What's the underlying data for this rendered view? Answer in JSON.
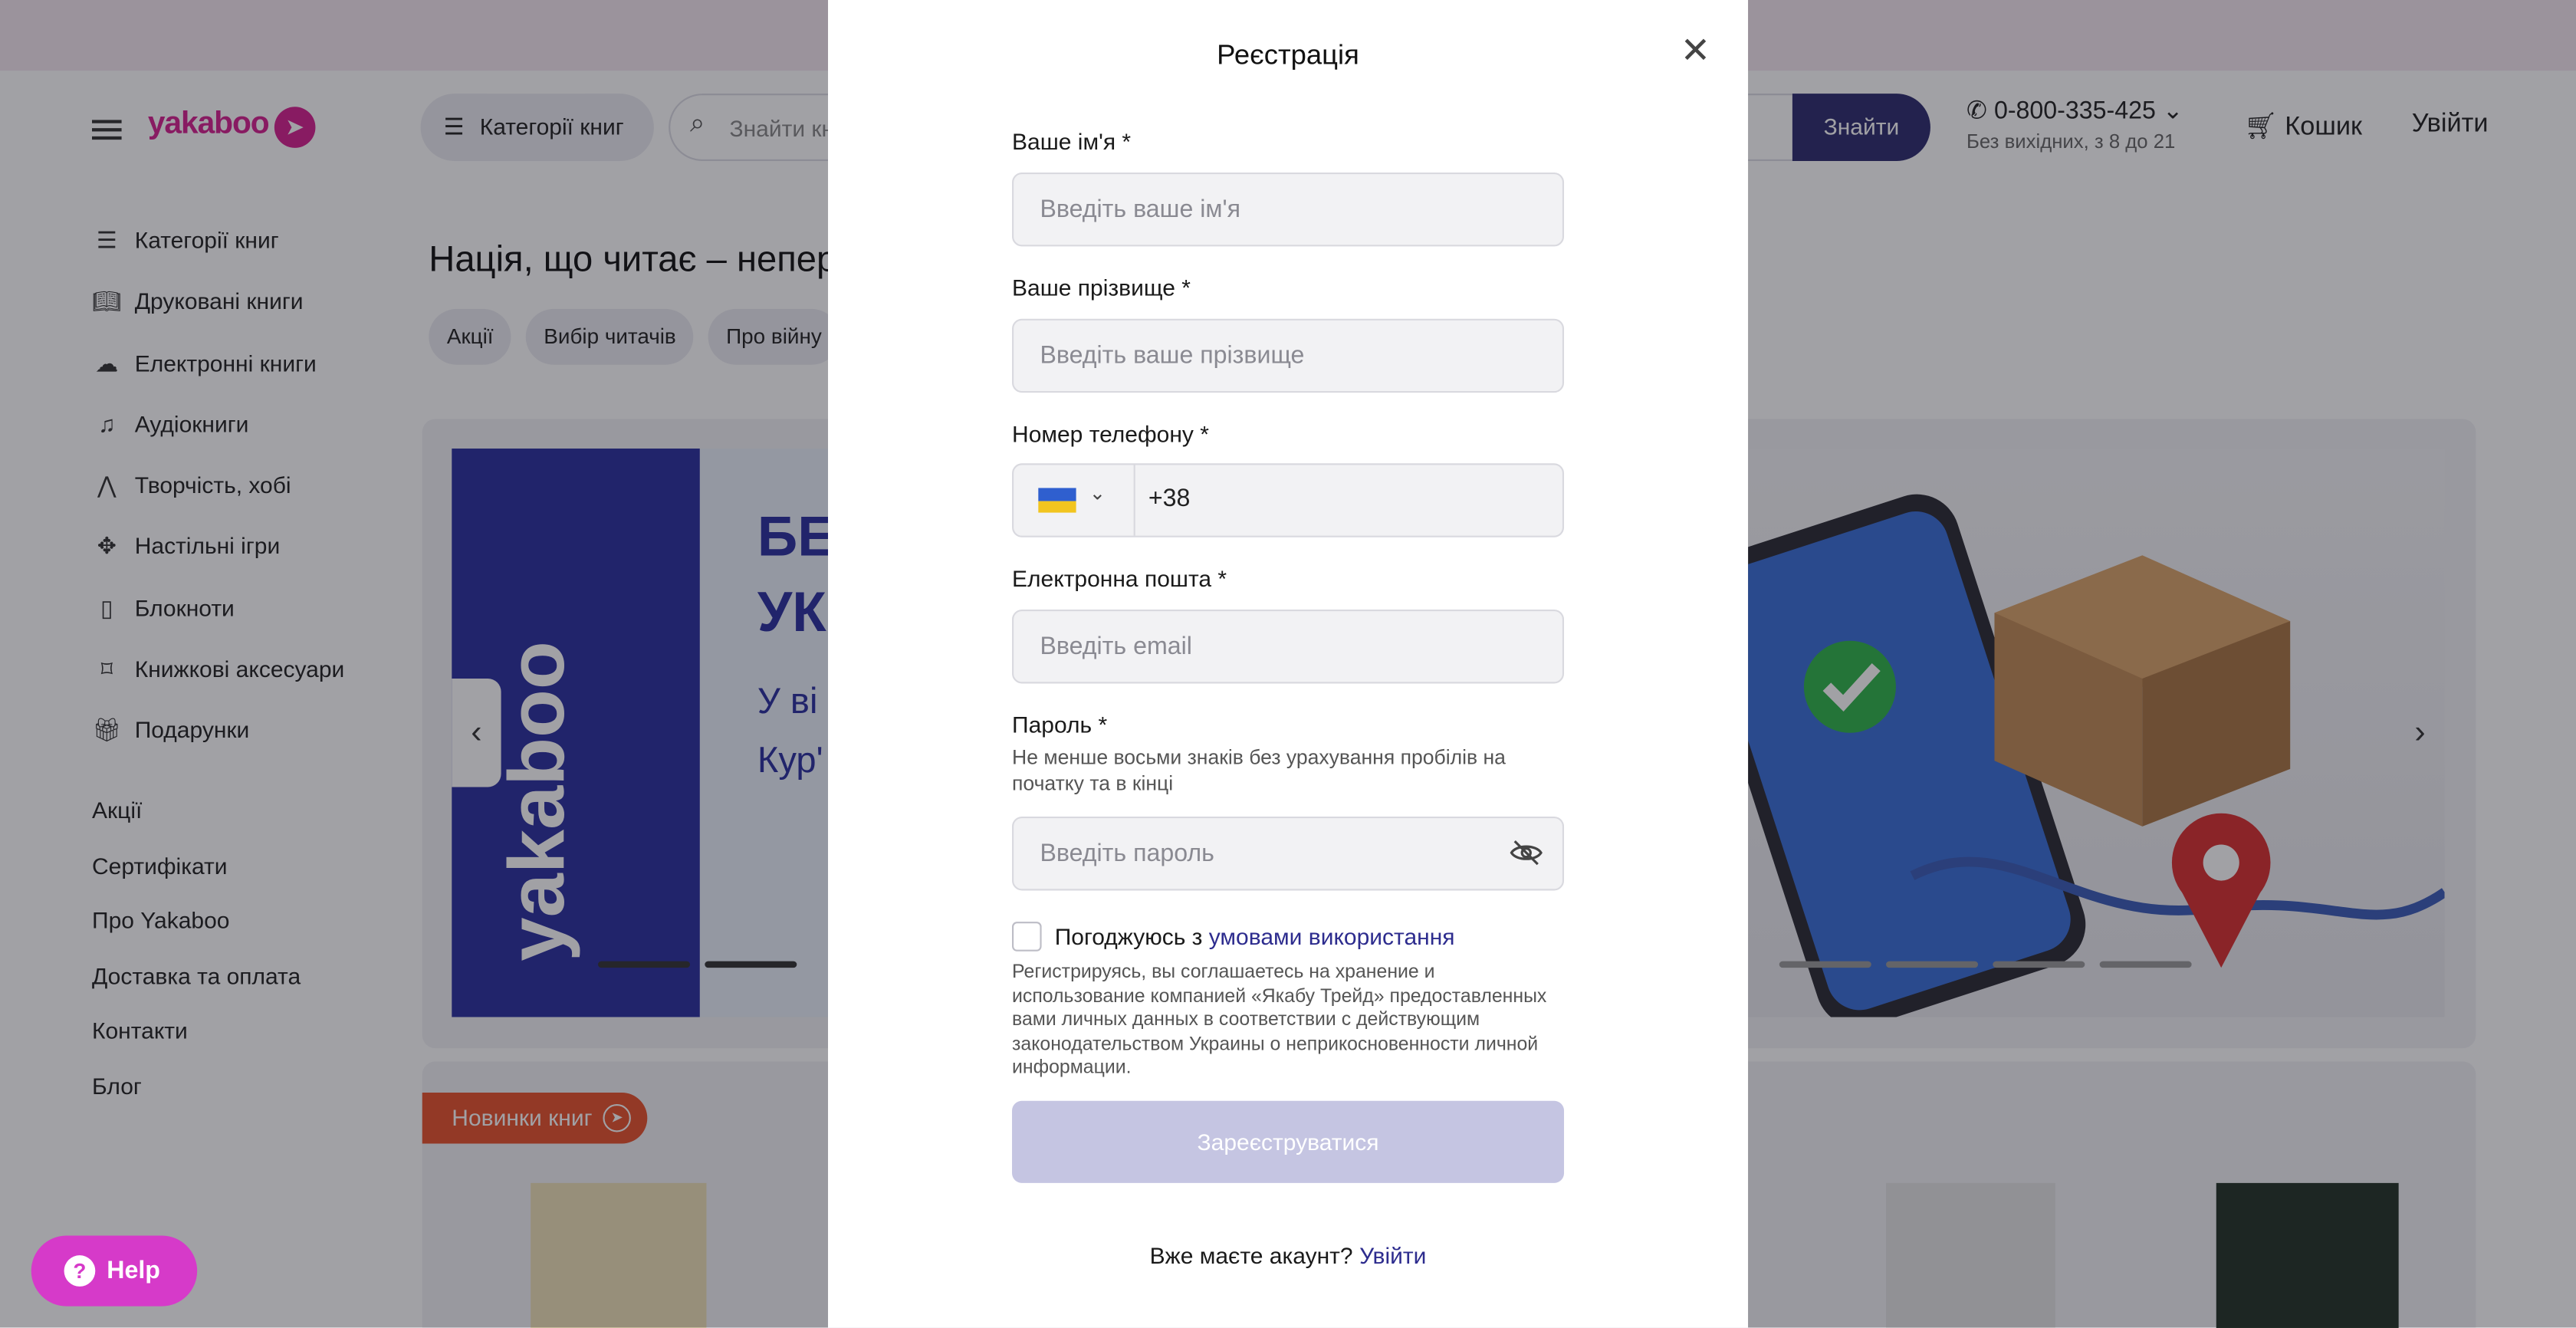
{
  "header": {
    "logo": "yakaboo",
    "categories_btn": "Категорії книг",
    "search_placeholder": "Знайти книгу, автора, серію",
    "search_btn": "Знайти",
    "phone": "0-800-335-425",
    "phone_hours": "Без вихідних, з 8 до 21",
    "cart": "Кошик",
    "login": "Увійти"
  },
  "sidebar": {
    "items": [
      {
        "label": "Категорії книг",
        "icon": "list-icon"
      },
      {
        "label": "Друковані книги",
        "icon": "book-icon"
      },
      {
        "label": "Електронні книги",
        "icon": "cloud-icon"
      },
      {
        "label": "Аудіокниги",
        "icon": "headphones-icon"
      },
      {
        "label": "Творчість, хобі",
        "icon": "brush-icon"
      },
      {
        "label": "Настільні ігри",
        "icon": "puzzle-icon"
      },
      {
        "label": "Блокноти",
        "icon": "notebook-icon"
      },
      {
        "label": "Книжкові аксесуари",
        "icon": "bookmark-icon"
      },
      {
        "label": "Подарунки",
        "icon": "gift-icon"
      }
    ],
    "links": [
      "Акції",
      "Сертифікати",
      "Про Yakaboo",
      "Доставка та оплата",
      "Контакти",
      "Блог"
    ]
  },
  "main": {
    "headline": "Нація, що читає – непер",
    "chips": [
      "Акції",
      "Вибір читачів",
      "Про війну"
    ],
    "banner": {
      "vertical_logo": "yakaboo",
      "line1": "БЕ",
      "line2": "УК",
      "line3": "У ві",
      "line4": "Кур'"
    },
    "news_tag": "Новинки книг"
  },
  "modal": {
    "title": "Реєстрація",
    "first_name_label": "Ваше ім'я *",
    "first_name_placeholder": "Введіть ваше ім'я",
    "last_name_label": "Ваше прізвище *",
    "last_name_placeholder": "Введіть ваше прізвище",
    "phone_label": "Номер телефону *",
    "phone_code": "+38",
    "email_label": "Електронна пошта *",
    "email_placeholder": "Введіть email",
    "password_label": "Пароль *",
    "password_hint": "Не менше восьми знаків без урахування пробілів на початку та в кінці",
    "password_placeholder": "Введіть пароль",
    "agree_text": "Погоджуюсь з",
    "agree_link": "умовами використання",
    "legal_text": "Регистрируясь, вы соглашаетесь на хранение и использование компанией «Якабу Трейд» предоставленных вами личных данных в соответствии с действующим законодательством Украины о неприкосновенности личной информации.",
    "submit": "Зареєструватися",
    "have_account": "Вже маєте акаунт?",
    "login_link": "Увійти"
  },
  "help_btn": "Help",
  "colors": {
    "brand_pink": "#d6208f",
    "navy": "#2d2c6e",
    "submit_disabled": "#c5c5e2",
    "news_orange": "#e8532c",
    "help_pink": "#d63ac9"
  }
}
